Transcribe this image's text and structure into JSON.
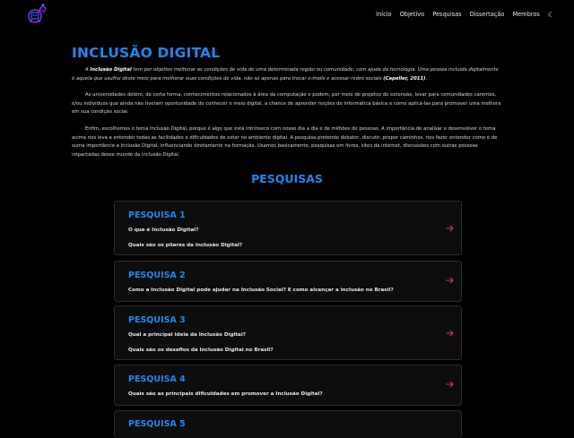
{
  "nav": {
    "items": [
      "Início",
      "Objetivo",
      "Pesquisas",
      "Dissertação",
      "Membros"
    ]
  },
  "intro": {
    "title": "INCLUSÃO DIGITAL",
    "p1_a": "A ",
    "p1_b": "Inclusão Digital",
    "p1_c": " tem por objetivo melhorar as condições de vida de uma determinada região ou comunidade, com ajuda da tecnologia. Uma pessoa incluída digitalmente é aquela que usufrui deste meio para melhorar suas condições de vida, não só apenas para trocar e-mails e acessar redes sociais ",
    "p1_d": "(Capeller, 2011)",
    "p1_e": ".",
    "p2": "As universidades detêm, de certa forma, conhecimentos relacionados à área da computação e podem, por meio de projetos de extensão, levar para comunidades carentes, e/ou indivíduos que ainda não tiveram oportunidade de conhecer o meio digital, a chance de aprender noções de informática básica e como aplicá-las para promover uma melhora em sua condição social.",
    "p3": "Enfim, escolhemos o tema Inclusão Digital, porque é algo que está intrínseco com nosso dia a dia e de milhões de pessoas. A importância de analisar e desenvolver o tema acima nos leva a entender todas as facilidades e dificuldades de estar no ambiente digital. A pesquisa pretende debater, discutir, propor caminhos, nos fazer entender como é de suma importância a Inclusão Digital, influenciando diretamente na formação. Usamos basicamente, pesquisas em livros, sites da internet, discussões com outras pessoas impactadas desse mundo da Inclusão Digital."
  },
  "research": {
    "title": "PESQUISAS",
    "cards": [
      {
        "title": "PESQUISA 1",
        "questions": [
          "O que é Inclusão Digital?",
          "Quais são os pilares da Inclusão Digital?"
        ]
      },
      {
        "title": "PESQUISA 2",
        "questions": [
          "Como a Inclusão Digital pode ajudar na Inclusão Social? E como alcançar a inclusão no Brasil?"
        ]
      },
      {
        "title": "PESQUISA 3",
        "questions": [
          "Qual a principal ideia da Inclusão Digital?",
          "Quais são os desafios da Inclusão Digital no Brasil?"
        ]
      },
      {
        "title": "PESQUISA 4",
        "questions": [
          "Quais são as principais dificuldades em promover a Inclusão Digital?"
        ]
      },
      {
        "title": "PESQUISA 5",
        "questions": []
      }
    ]
  },
  "colors": {
    "accent": "#1e88f0",
    "arrow": "#e0307a",
    "background": "#000000",
    "card": "#0d0d0d"
  },
  "icons": {
    "logo": "robot-logo-icon",
    "theme": "moon-icon",
    "card_arrow": "arrow-right-icon"
  }
}
